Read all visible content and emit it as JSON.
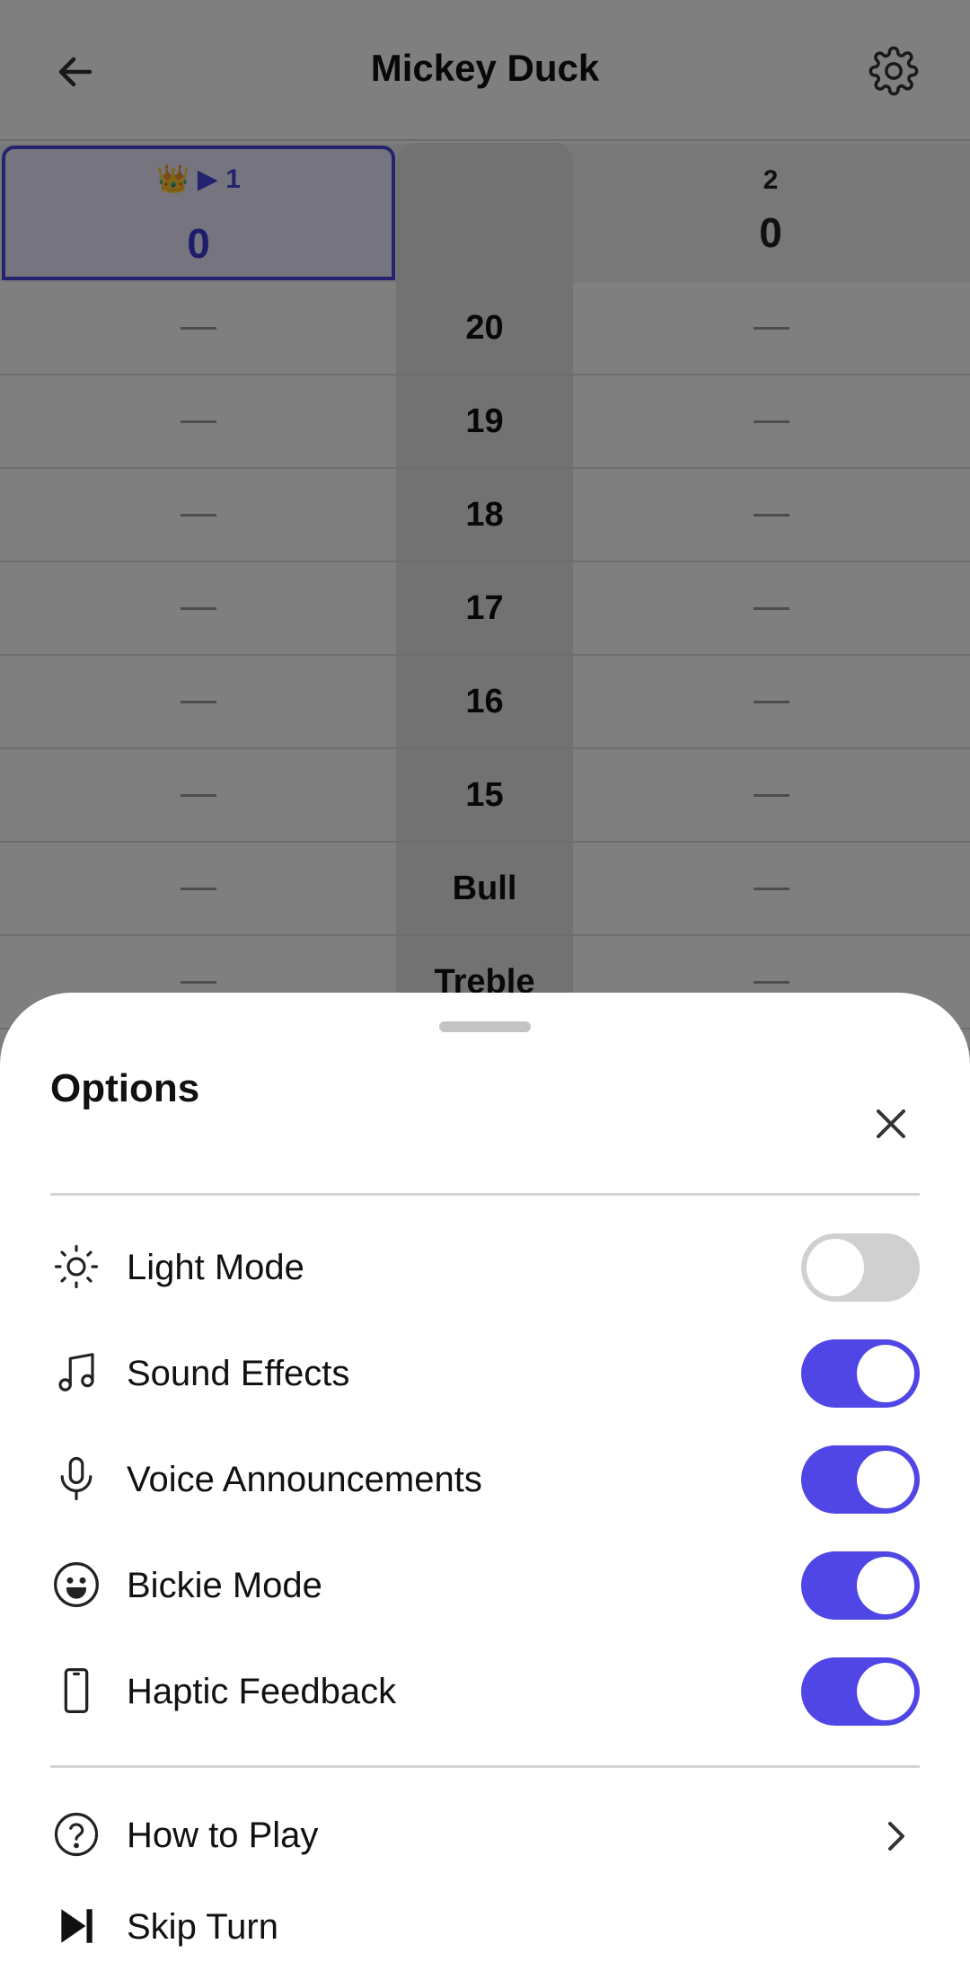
{
  "header": {
    "title": "Mickey Duck",
    "back_icon": "arrow-left-icon",
    "settings_icon": "gear-icon"
  },
  "players": [
    {
      "marker": "▶ 1",
      "crown": "👑",
      "score": "0",
      "active": true
    },
    {
      "number": "2",
      "score": "0",
      "active": false
    }
  ],
  "scoreboard": {
    "rows": [
      {
        "label": "20",
        "p1": "",
        "p2": ""
      },
      {
        "label": "19",
        "p1": "",
        "p2": ""
      },
      {
        "label": "18",
        "p1": "",
        "p2": ""
      },
      {
        "label": "17",
        "p1": "",
        "p2": ""
      },
      {
        "label": "16",
        "p1": "",
        "p2": ""
      },
      {
        "label": "15",
        "p1": "",
        "p2": ""
      },
      {
        "label": "Bull",
        "p1": "",
        "p2": ""
      },
      {
        "label": "Treble",
        "p1": "",
        "p2": ""
      }
    ]
  },
  "options": {
    "title": "Options",
    "close_icon": "close-icon",
    "toggles": [
      {
        "label": "Light Mode",
        "icon": "sun-icon",
        "on": false
      },
      {
        "label": "Sound Effects",
        "icon": "music-note-icon",
        "on": true
      },
      {
        "label": "Voice Announcements",
        "icon": "microphone-icon",
        "on": true
      },
      {
        "label": "Bickie Mode",
        "icon": "smiley-icon",
        "on": true
      },
      {
        "label": "Haptic Feedback",
        "icon": "phone-icon",
        "on": true
      }
    ],
    "links": [
      {
        "label": "How to Play",
        "icon": "help-circle-icon"
      },
      {
        "label": "Skip Turn",
        "icon": "skip-forward-icon"
      }
    ]
  },
  "colors": {
    "accent": "#4f46e5",
    "toggle_off": "#d0d0d0"
  }
}
